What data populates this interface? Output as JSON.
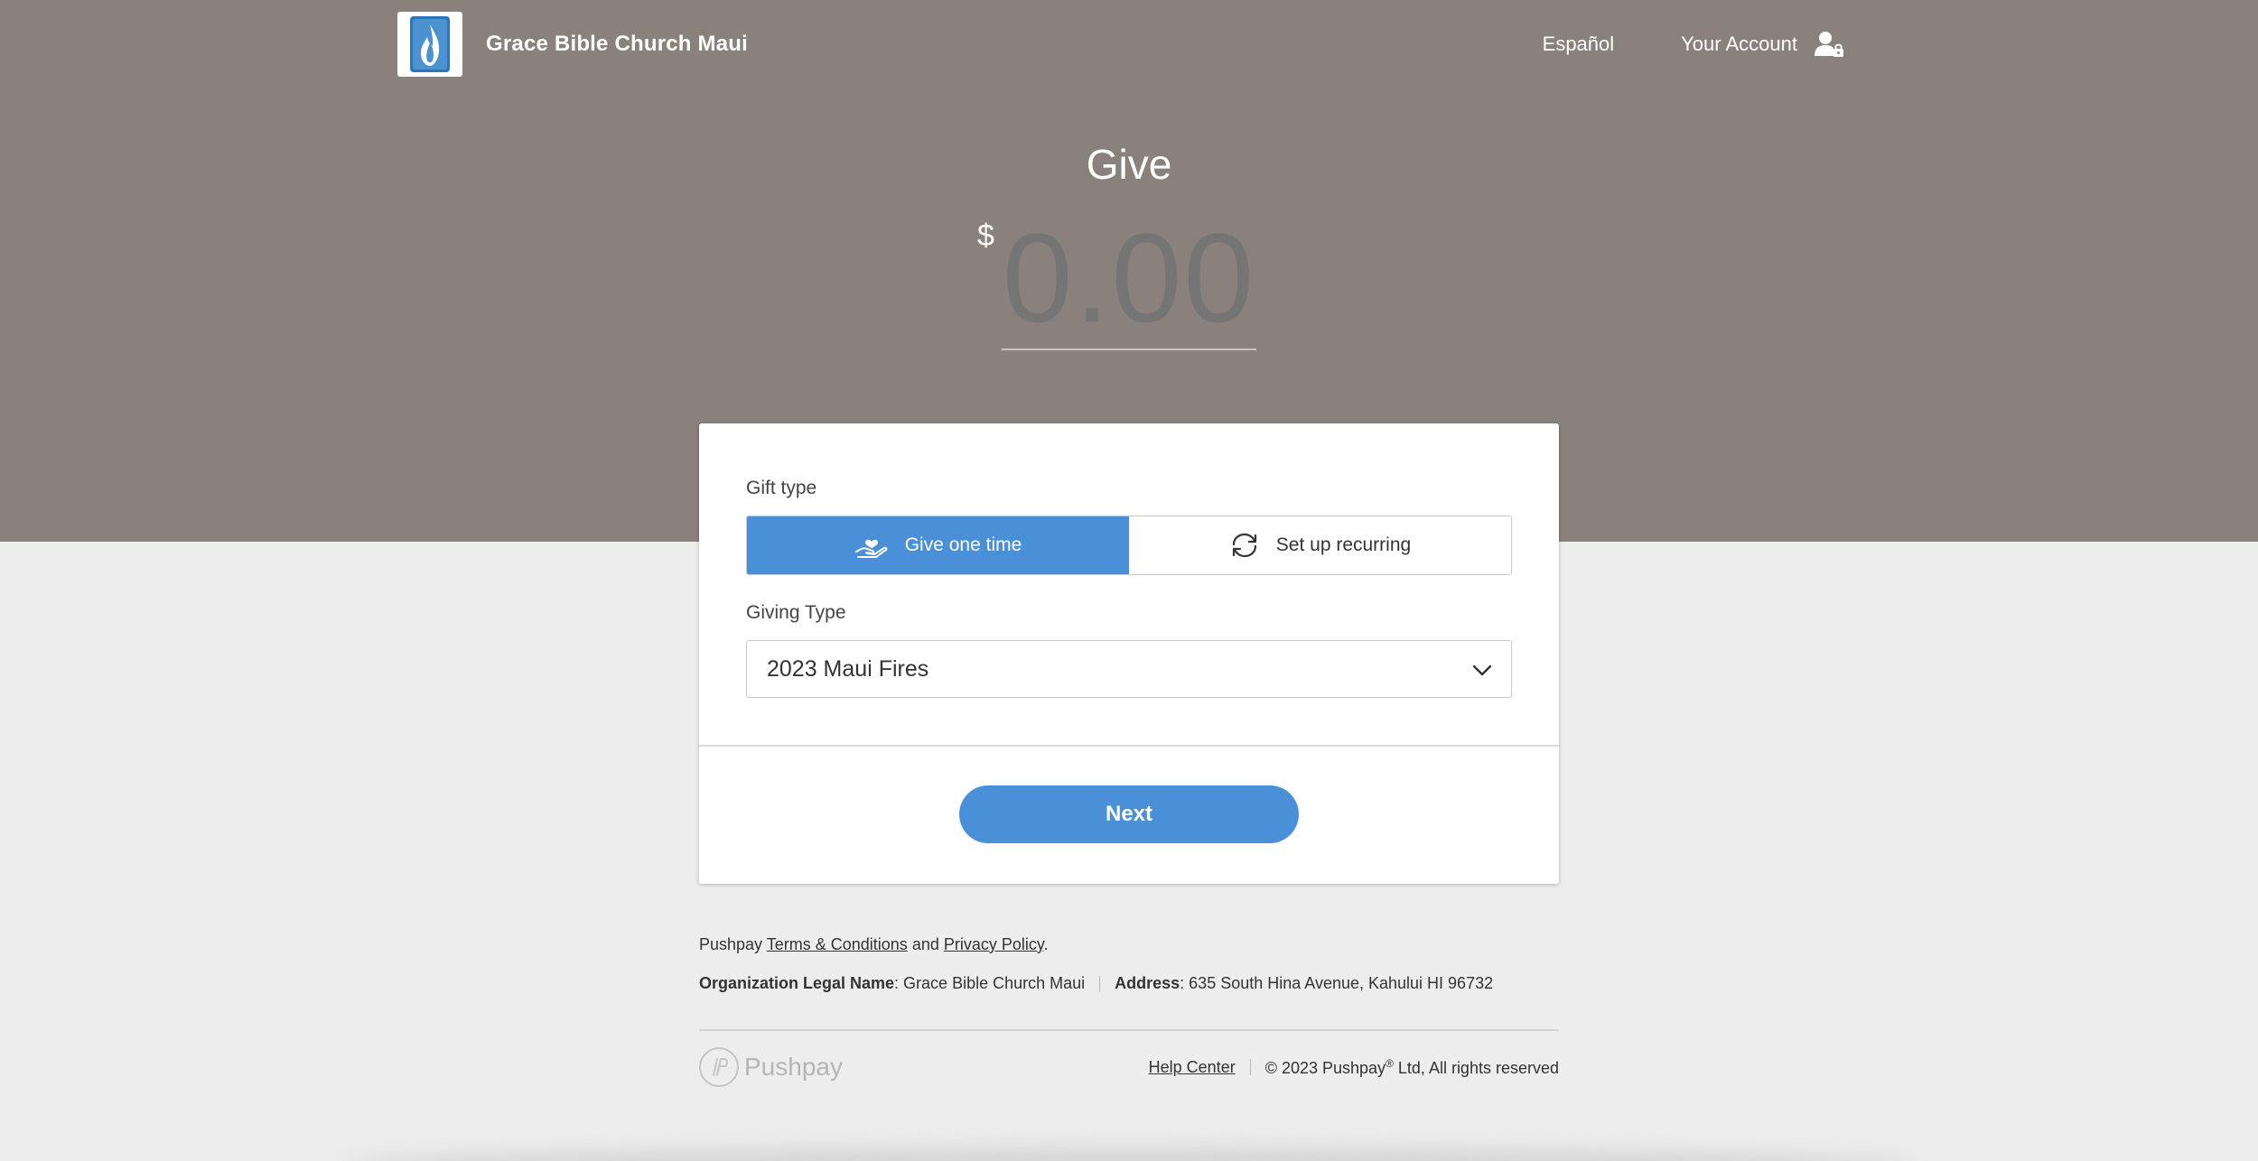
{
  "header": {
    "org_name": "Grace Bible Church Maui",
    "language_link": "Español",
    "account_link": "Your Account"
  },
  "give": {
    "title": "Give",
    "currency_symbol": "$",
    "amount_placeholder": "0.00"
  },
  "form": {
    "gift_type_label": "Gift type",
    "gift_type_options": [
      "Give one time",
      "Set up recurring"
    ],
    "gift_type_selected": "Give one time",
    "giving_type_label": "Giving Type",
    "giving_type_value": "2023 Maui Fires",
    "next_label": "Next"
  },
  "footer": {
    "terms_prefix": "Pushpay",
    "terms_link": "Terms & Conditions",
    "and_text": "and",
    "privacy_link": "Privacy Policy",
    "period": ".",
    "legal_name_label": "Organization Legal Name",
    "legal_name_value": ": Grace Bible Church Maui",
    "address_label": "Address",
    "address_value": ": 635 South Hina Avenue, Kahului HI 96732",
    "brand_name": "Pushpay",
    "help_link": "Help Center",
    "copyright_prefix": "© 2023 Pushpay",
    "copyright_mark": "®",
    "copyright_suffix": " Ltd, All rights reserved"
  },
  "colors": {
    "hero_bg": "#8a817c",
    "accent": "#4a90d9",
    "page_bg": "#ededed"
  },
  "icons": {
    "logo": "flame-logo-icon",
    "account": "user-lock-icon",
    "one_time": "hand-heart-icon",
    "recurring": "refresh-icon",
    "select": "chevron-down-icon"
  }
}
